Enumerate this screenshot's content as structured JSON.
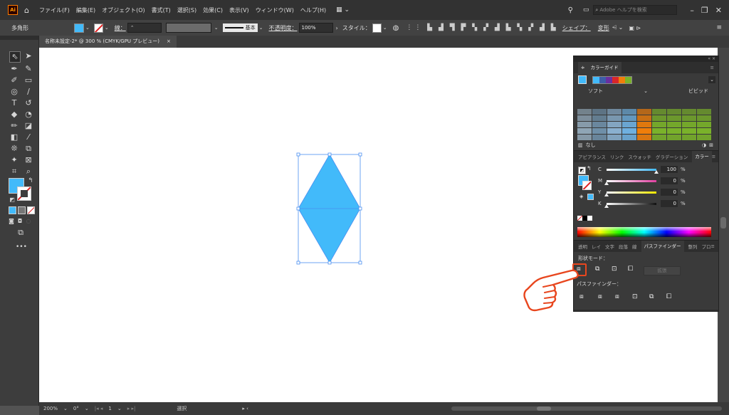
{
  "menubar": {
    "logo": "Ai",
    "items": [
      "ファイル(F)",
      "編集(E)",
      "オブジェクト(O)",
      "書式(T)",
      "選択(S)",
      "効果(C)",
      "表示(V)",
      "ウィンドウ(W)",
      "ヘルプ(H)"
    ],
    "search_placeholder": "Adobe ヘルプを検索"
  },
  "controlbar": {
    "object_type": "多角形",
    "stroke_label": "線：",
    "stroke_style": "基本",
    "opacity_label": "不透明度：",
    "opacity_value": "100%",
    "style_label": "スタイル：",
    "shape_label": "シェイプ：",
    "transform_label": "変形"
  },
  "document_tab": {
    "title": "名称未設定-2* @ 300 % (CMYK/GPU プレビュー)",
    "close": "×"
  },
  "color_guide": {
    "title": "カラーガイド",
    "left_label": "ソフト",
    "right_label": "ビビッド",
    "none_label": "なし",
    "harmony_colors": [
      "#42bafa",
      "#3d5ea8",
      "#6a2fa0",
      "#d8262a",
      "#f07e0a",
      "#7ab22a"
    ]
  },
  "color_panel": {
    "tabs": [
      "アピアランス",
      "リンク",
      "スウォッチ",
      "グラデーション",
      "カラー"
    ],
    "channels": [
      {
        "name": "C",
        "value": "100",
        "unit": "%"
      },
      {
        "name": "M",
        "value": "0",
        "unit": "%"
      },
      {
        "name": "Y",
        "value": "0",
        "unit": "%"
      },
      {
        "name": "K",
        "value": "0",
        "unit": "%"
      }
    ]
  },
  "pathfinder": {
    "tabs": [
      "透明",
      "レイ",
      "文字",
      "段落",
      "線",
      "パスファインダー",
      "整列",
      "プロ"
    ],
    "shape_modes_label": "形状モード：",
    "expand_label": "拡張",
    "pathfinders_label": "パスファインダー："
  },
  "statusbar": {
    "zoom": "200%",
    "rotation": "0°",
    "artboard": "1",
    "tool": "選択"
  },
  "colors": {
    "fill": "#42bafa",
    "accent_highlight": "#e8461e"
  }
}
